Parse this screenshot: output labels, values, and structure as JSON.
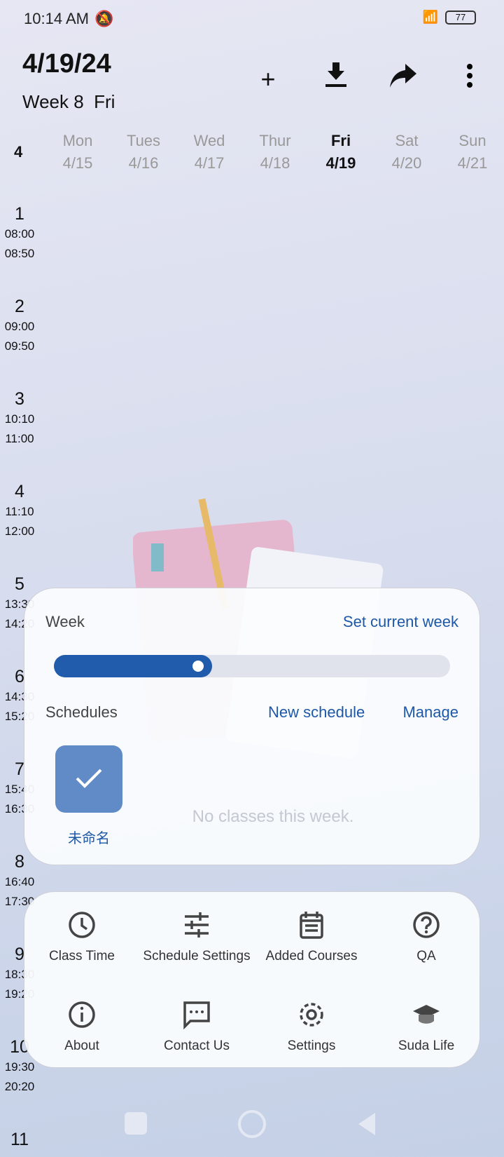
{
  "status_bar": {
    "time": "10:14 AM",
    "battery": "77"
  },
  "header": {
    "date": "4/19/24",
    "week_label": "Week 8",
    "weekday": "Fri",
    "actions": [
      "add",
      "import",
      "share",
      "more"
    ]
  },
  "month": "4",
  "days": [
    {
      "name": "Mon",
      "date": "4/15"
    },
    {
      "name": "Tues",
      "date": "4/16"
    },
    {
      "name": "Wed",
      "date": "4/17"
    },
    {
      "name": "Thur",
      "date": "4/18"
    },
    {
      "name": "Fri",
      "date": "4/19",
      "today": true
    },
    {
      "name": "Sat",
      "date": "4/20"
    },
    {
      "name": "Sun",
      "date": "4/21"
    }
  ],
  "slots": [
    {
      "n": "1",
      "start": "08:00",
      "end": "08:50"
    },
    {
      "n": "2",
      "start": "09:00",
      "end": "09:50"
    },
    {
      "n": "3",
      "start": "10:10",
      "end": "11:00"
    },
    {
      "n": "4",
      "start": "11:10",
      "end": "12:00"
    },
    {
      "n": "5",
      "start": "13:30",
      "end": "14:20"
    },
    {
      "n": "6",
      "start": "14:30",
      "end": "15:20"
    },
    {
      "n": "7",
      "start": "15:40",
      "end": "16:30"
    },
    {
      "n": "8",
      "start": "16:40",
      "end": "17:30"
    },
    {
      "n": "9",
      "start": "18:30",
      "end": "19:20"
    },
    {
      "n": "10",
      "start": "19:30",
      "end": "20:20"
    },
    {
      "n": "11",
      "start": "",
      "end": ""
    }
  ],
  "empty_text": "No classes this week.",
  "week_panel": {
    "week_label": "Week",
    "set_current": "Set current week",
    "slider_fraction": 0.4,
    "schedules_label": "Schedules",
    "new_schedule": "New schedule",
    "manage": "Manage",
    "schedule_name": "未命名",
    "accent": "#205bac"
  },
  "menu": [
    {
      "label": "Class Time",
      "icon": "clock-icon"
    },
    {
      "label": "Schedule Settings",
      "icon": "sliders-icon"
    },
    {
      "label": "Added Courses",
      "icon": "calendar-icon"
    },
    {
      "label": "QA",
      "icon": "help-icon"
    },
    {
      "label": "About",
      "icon": "info-icon"
    },
    {
      "label": "Contact Us",
      "icon": "chat-icon"
    },
    {
      "label": "Settings",
      "icon": "gear-icon"
    },
    {
      "label": "Suda Life",
      "icon": "graduation-cap-icon"
    }
  ]
}
